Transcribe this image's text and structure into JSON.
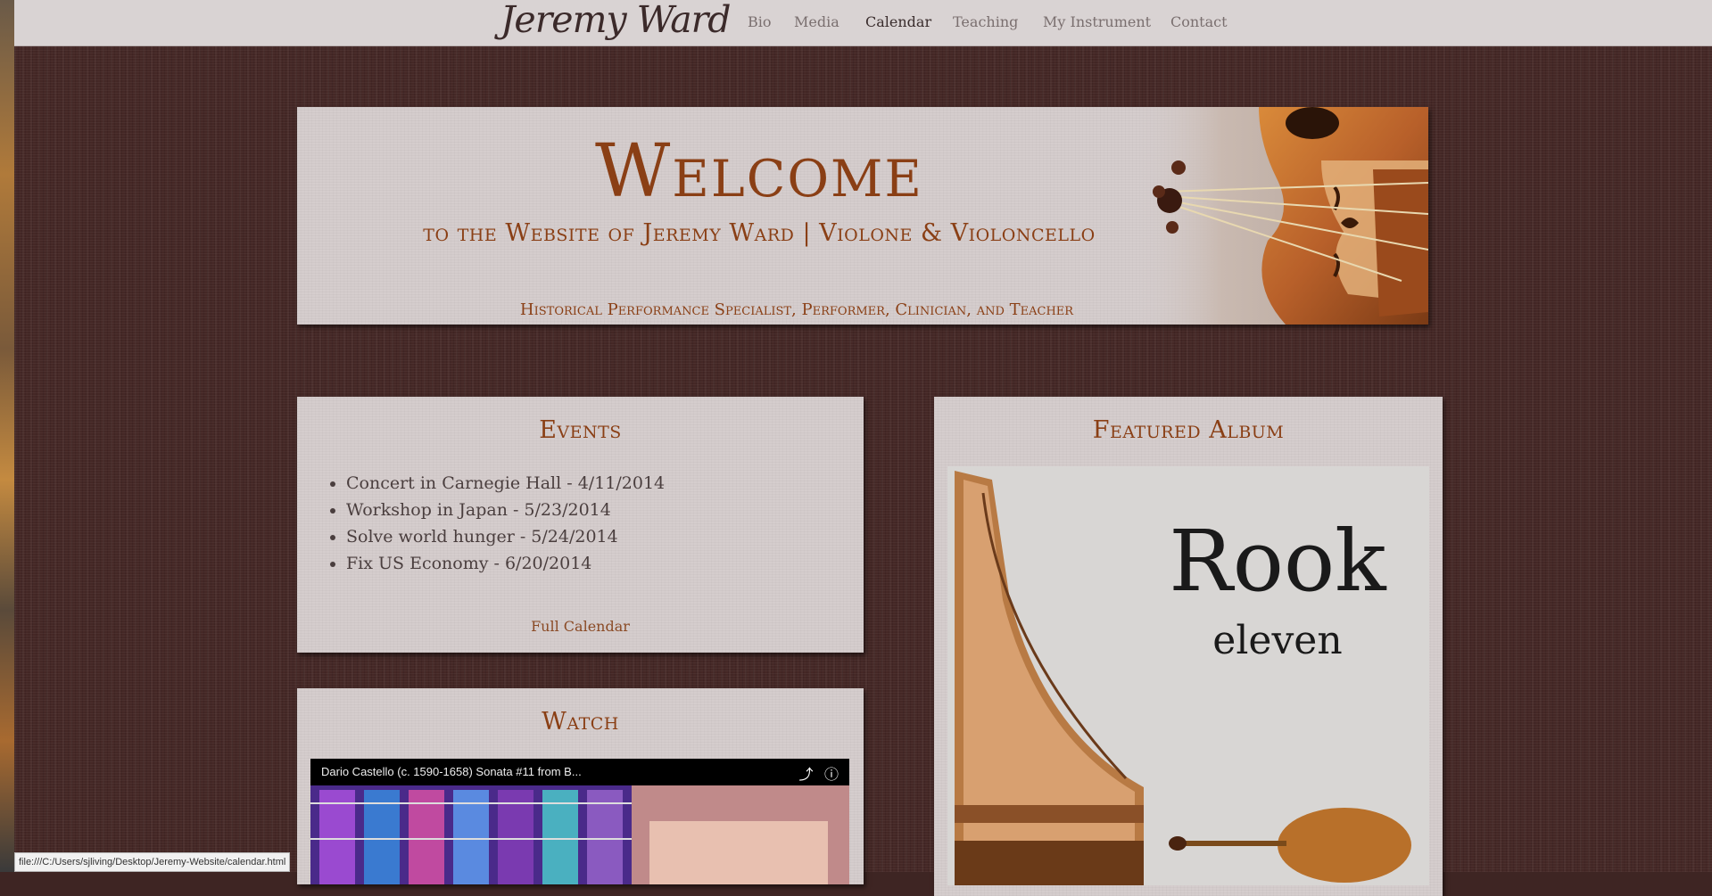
{
  "nav": {
    "brand": "Jeremy Ward",
    "items": [
      {
        "label": "Bio",
        "active": false
      },
      {
        "label": "Media",
        "active": false
      },
      {
        "label": "Calendar",
        "active": true
      },
      {
        "label": "Teaching",
        "active": false
      },
      {
        "label": "My Instrument",
        "active": false
      },
      {
        "label": "Contact",
        "active": false
      }
    ]
  },
  "hero": {
    "title": "Welcome",
    "subtitle": "to the Website of Jeremy Ward | Violone & Violoncello",
    "tagline": "Historical Performance Specialist, Performer, Clinician, and Teacher"
  },
  "events": {
    "title": "Events",
    "items": [
      "Concert in Carnegie Hall - 4/11/2014",
      "Workshop in Japan - 5/23/2014",
      "Solve world hunger - 5/24/2014",
      "Fix US Economy - 6/20/2014"
    ],
    "link": "Full Calendar"
  },
  "watch": {
    "title": "Watch",
    "video_title": "Dario Castello (c. 1590-1658) Sonata #11 from B..."
  },
  "album": {
    "title": "Featured Album",
    "cover_title": "Rook",
    "cover_subtitle": "eleven"
  },
  "status": {
    "url": "file:///C:/Users/sjliving/Desktop/Jeremy-Website/calendar.html"
  },
  "colors": {
    "accent": "#8a3f15",
    "background": "#452826",
    "panel": "#d5cdcd"
  }
}
